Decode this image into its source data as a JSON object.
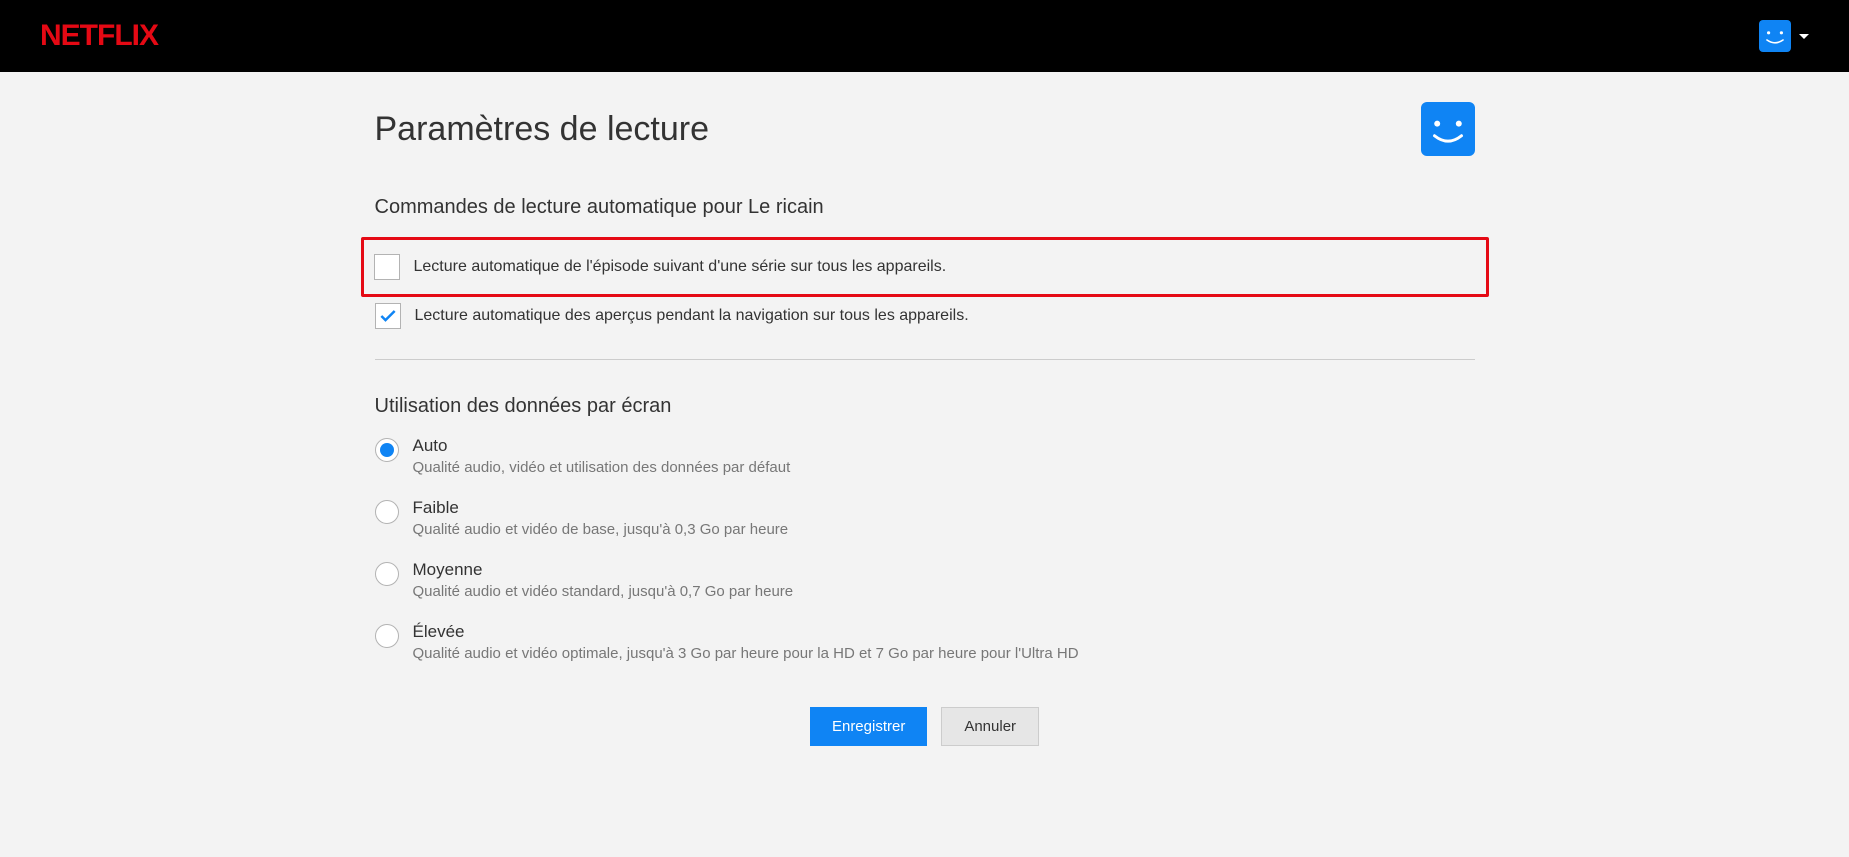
{
  "header": {
    "logo": "NETFLIX"
  },
  "page": {
    "title": "Paramètres de lecture"
  },
  "autoplay": {
    "heading": "Commandes de lecture automatique pour Le ricain",
    "options": [
      {
        "label": "Lecture automatique de l'épisode suivant d'une série sur tous les appareils.",
        "checked": false
      },
      {
        "label": "Lecture automatique des aperçus pendant la navigation sur tous les appareils.",
        "checked": true
      }
    ]
  },
  "dataUsage": {
    "heading": "Utilisation des données par écran",
    "options": [
      {
        "label": "Auto",
        "description": "Qualité audio, vidéo et utilisation des données par défaut",
        "selected": true
      },
      {
        "label": "Faible",
        "description": "Qualité audio et vidéo de base, jusqu'à 0,3 Go par heure",
        "selected": false
      },
      {
        "label": "Moyenne",
        "description": "Qualité audio et vidéo standard, jusqu'à 0,7 Go par heure",
        "selected": false
      },
      {
        "label": "Élevée",
        "description": "Qualité audio et vidéo optimale, jusqu'à 3 Go par heure pour la HD et 7 Go par heure pour l'Ultra HD",
        "selected": false
      }
    ]
  },
  "buttons": {
    "save": "Enregistrer",
    "cancel": "Annuler"
  }
}
